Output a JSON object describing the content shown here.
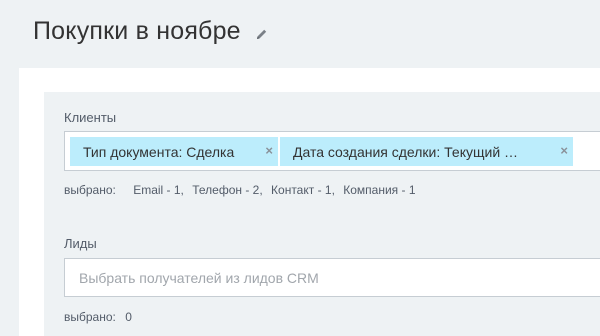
{
  "header": {
    "title": "Покупки в ноябре",
    "edit_icon": "pencil-icon"
  },
  "clients": {
    "label": "Клиенты",
    "tags": [
      {
        "label": "Тип документа: Сделка",
        "close_icon": "close-icon"
      },
      {
        "label": "Дата создания сделки: Текущий …",
        "close_icon": "close-icon"
      }
    ],
    "selected": {
      "prefix": "выбрано:",
      "items": [
        "Email - 1,",
        "Телефон - 2,",
        "Контакт - 1,",
        "Компания - 1"
      ]
    }
  },
  "leads": {
    "label": "Лиды",
    "placeholder": "Выбрать получателей из лидов CRM",
    "value": "",
    "selected": {
      "prefix": "выбрано:",
      "count": "0"
    }
  },
  "colors": {
    "tag_background": "#bcedfc",
    "page_background": "#eef2f4"
  }
}
